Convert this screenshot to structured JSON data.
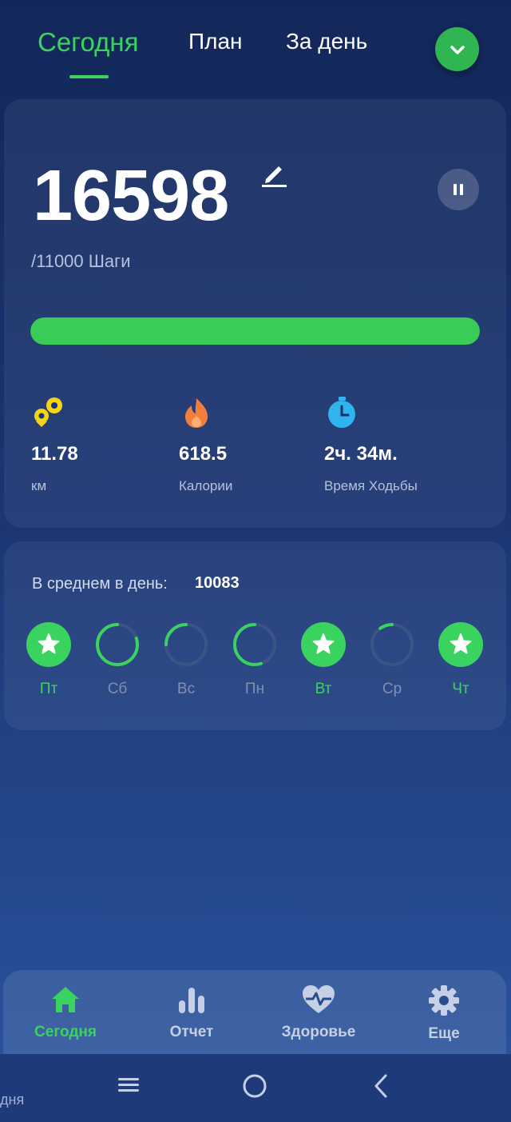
{
  "tabs": {
    "today": "Сегодня",
    "plan": "План",
    "per_day": "За день"
  },
  "summary": {
    "steps": "16598",
    "goal_text": "/11000 Шаги",
    "progress": 1.0,
    "progress_color": "#39cc58"
  },
  "stats": [
    {
      "icon": "distance-pin-icon",
      "value": "11.78",
      "label": "км",
      "color": "#f4d516"
    },
    {
      "icon": "flame-icon",
      "value": "618.5",
      "label": "Калории",
      "color": "#f37d3a"
    },
    {
      "icon": "stopwatch-icon",
      "value": "2ч. 34м.",
      "label": "Время Ходьбы",
      "color": "#2fb4f0"
    }
  ],
  "week": {
    "avg_label": "В среднем в день:",
    "avg_value": "10083",
    "days": [
      {
        "label": "Пт",
        "progress": 1.0,
        "done": true
      },
      {
        "label": "Сб",
        "progress": 0.8,
        "done": false
      },
      {
        "label": "Вс",
        "progress": 0.25,
        "done": false
      },
      {
        "label": "Пн",
        "progress": 0.55,
        "done": false
      },
      {
        "label": "Вт",
        "progress": 1.0,
        "done": true
      },
      {
        "label": "Ср",
        "progress": 0.1,
        "done": false
      },
      {
        "label": "Чт",
        "progress": 1.0,
        "done": true
      }
    ]
  },
  "nav": [
    {
      "icon": "home-icon",
      "label": "Сегодня",
      "active": true
    },
    {
      "icon": "bar-chart-icon",
      "label": "Отчет",
      "active": false
    },
    {
      "icon": "heart-pulse-icon",
      "label": "Здоровье",
      "active": false
    },
    {
      "icon": "gear-icon",
      "label": "Еще",
      "active": false
    }
  ],
  "edge_text": "дня",
  "colors": {
    "accent": "#3bd360",
    "background": "#1b3572"
  }
}
